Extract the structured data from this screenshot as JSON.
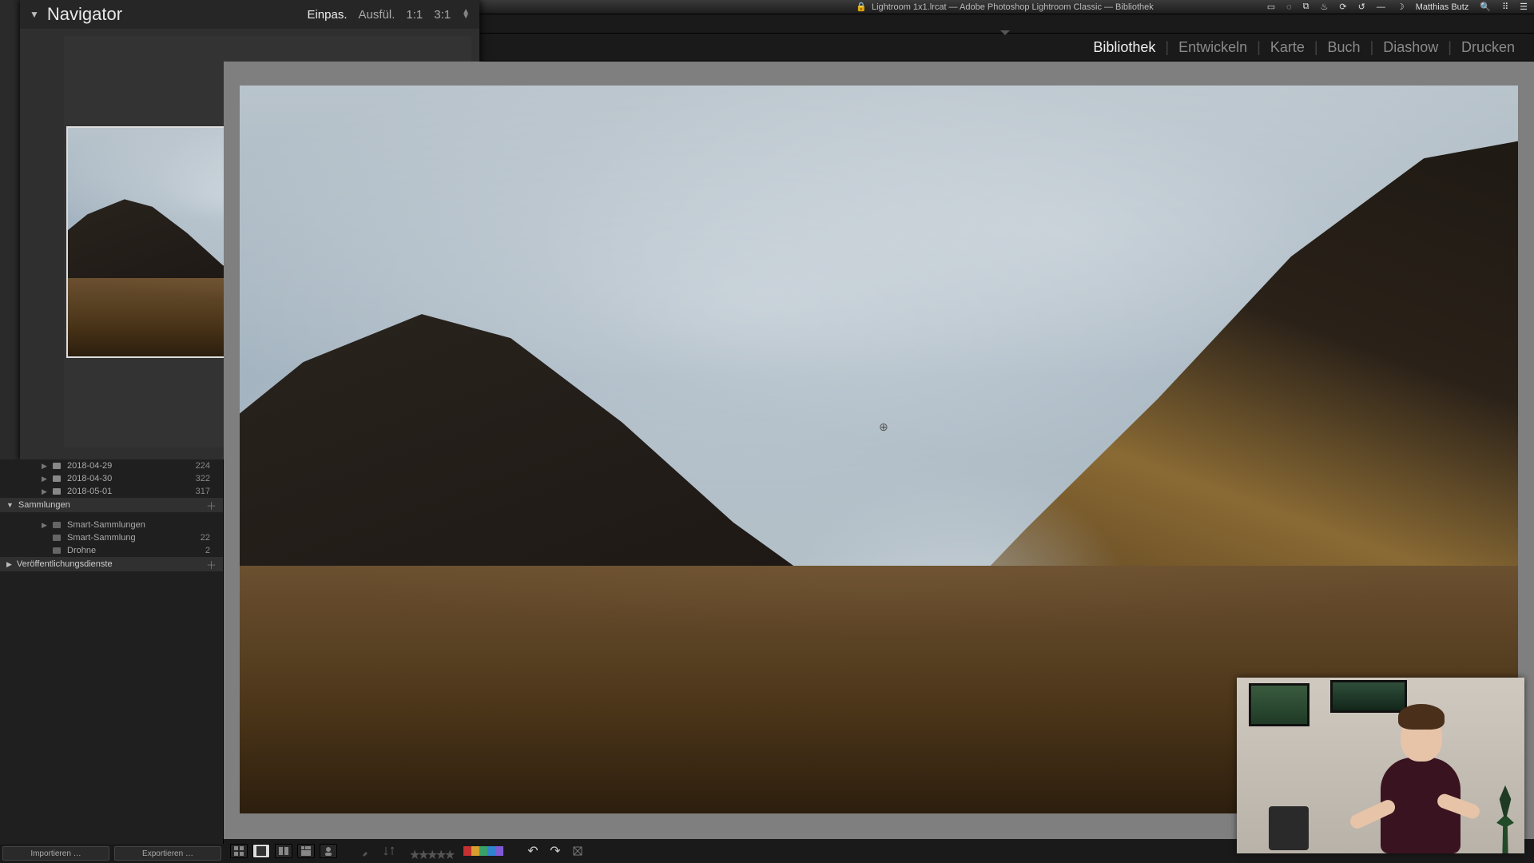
{
  "menubar": {
    "window_title": "Lightroom 1x1.lrcat — Adobe Photoshop Lightroom Classic — Bibliothek",
    "user_name": "Matthias Butz"
  },
  "modules": {
    "items": [
      {
        "label": "Bibliothek",
        "active": true
      },
      {
        "label": "Entwickeln",
        "active": false
      },
      {
        "label": "Karte",
        "active": false
      },
      {
        "label": "Buch",
        "active": false
      },
      {
        "label": "Diashow",
        "active": false
      },
      {
        "label": "Drucken",
        "active": false
      }
    ],
    "separator": "|"
  },
  "navigator": {
    "title": "Navigator",
    "zoom": {
      "fit": "Einpas.",
      "fill": "Ausfül.",
      "one_to_one": "1:1",
      "ratio": "3:1"
    }
  },
  "folders": {
    "dates": [
      {
        "name": "2018-04-29",
        "count": "224"
      },
      {
        "name": "2018-04-30",
        "count": "322"
      },
      {
        "name": "2018-05-01",
        "count": "317"
      }
    ]
  },
  "collections": {
    "header": "Sammlungen",
    "items": [
      {
        "name": "Smart-Sammlungen",
        "count": ""
      },
      {
        "name": "Smart-Sammlung",
        "count": "22"
      },
      {
        "name": "Drohne",
        "count": "2"
      }
    ]
  },
  "publish": {
    "header": "Veröffentlichungsdienste"
  },
  "left_buttons": {
    "import": "Importieren …",
    "export": "Exportieren …"
  },
  "toolbar": {
    "colors": [
      "#c53030",
      "#d69e2e",
      "#38a169",
      "#3182ce",
      "#805ad5"
    ]
  }
}
